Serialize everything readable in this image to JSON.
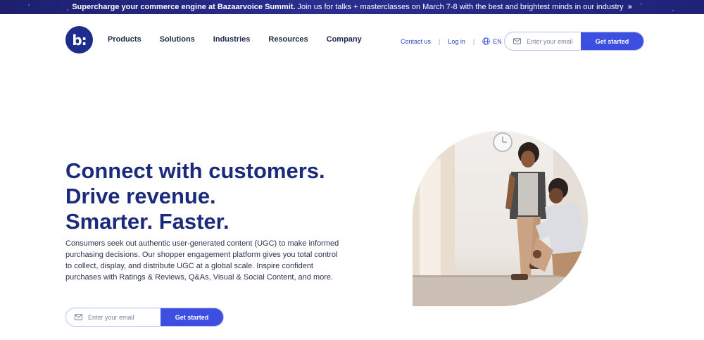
{
  "banner": {
    "headline": "Supercharge your commerce engine at Bazaarvoice Summit.",
    "message": "Join us for talks + masterclasses on March 7-8 with the best and brightest minds in our industry",
    "chevron": "»"
  },
  "logo": {
    "text": "b:"
  },
  "nav": {
    "items": [
      "Products",
      "Solutions",
      "Industries",
      "Resources",
      "Company"
    ]
  },
  "utility": {
    "contact": "Contact us",
    "login": "Log in",
    "language": "EN",
    "separator": "|"
  },
  "header_form": {
    "placeholder": "Enter your email",
    "button": "Get started"
  },
  "hero": {
    "title_lines": [
      "Connect with customers.",
      "Drive revenue.",
      "Smarter. Faster."
    ],
    "description": "Consumers seek out authentic user-generated content (UGC) to make informed purchasing decisions. Our shopper engagement platform gives you total control to collect, display, and distribute UGC at a global scale. Inspire confident purchases with Ratings & Reviews, Q&As, Visual & Social Content, and more.",
    "form": {
      "placeholder": "Enter your email",
      "button": "Get started"
    }
  },
  "colors": {
    "brand_navy": "#1b2a7a",
    "accent_blue": "#3d4fe0",
    "banner_bg": "#1d1f6e"
  },
  "icons": {
    "email": "mail-icon",
    "language": "globe-icon"
  }
}
